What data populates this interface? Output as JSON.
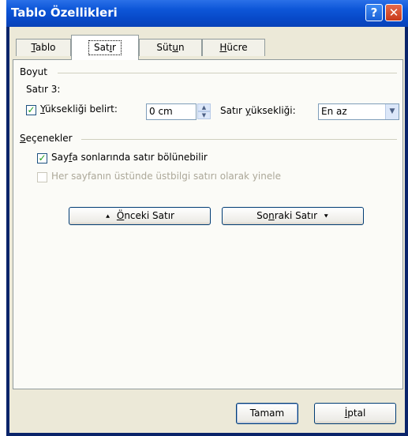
{
  "window": {
    "title": "Tablo Özellikleri",
    "help_glyph": "?",
    "close_glyph": "✕"
  },
  "tabs": [
    {
      "label": "Tablo",
      "accel": "T",
      "rest": "ablo"
    },
    {
      "label": "Satır",
      "pre": "Sat",
      "accel": "ı",
      "rest": "r"
    },
    {
      "label": "Sütun",
      "pre": "Süt",
      "accel": "u",
      "rest": "n"
    },
    {
      "label": "Hücre",
      "accel": "H",
      "rest": "ücre"
    }
  ],
  "active_tab": "Satır",
  "boyut": {
    "group_label": "Boyut",
    "row_label": "Satır 3:",
    "height_checkbox": {
      "label": "Yüksekliği belirt:",
      "accel": "Y",
      "rest": "üksekliği belirt:",
      "checked": true
    },
    "height_value": "0 cm",
    "row_height_label": {
      "pre": "Satır ",
      "accel": "y",
      "rest": "üksekliği:"
    },
    "row_height_select": "En az"
  },
  "secenekler": {
    "group_label": "Seçenekler",
    "accel": "S",
    "rest": "eçenekler",
    "allow_break": {
      "pre": "Say",
      "accel": "f",
      "rest": "a sonlarında satır bölünebilir",
      "checked": true
    },
    "repeat_header": {
      "label": "Her sayfanın üstünde üstbilgi satırı olarak yinele",
      "checked": false,
      "disabled": true
    }
  },
  "nav": {
    "prev": {
      "icon": "⯅",
      "accel": "Ö",
      "rest": "nceki Satır"
    },
    "next": {
      "pre": "So",
      "accel": "n",
      "rest": "raki Satır",
      "icon": "⯆"
    }
  },
  "footer": {
    "ok_label": "Tamam",
    "cancel": {
      "accel": "İ",
      "rest": "ptal"
    }
  }
}
